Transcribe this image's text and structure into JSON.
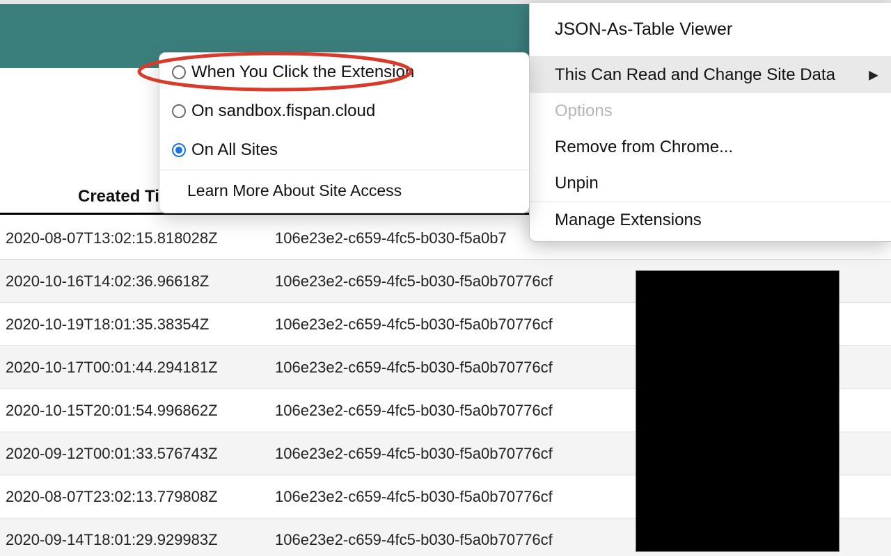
{
  "header": {
    "created_col": "Created Ti"
  },
  "rows": [
    {
      "created": "2020-08-07T13:02:15.818028Z",
      "id": "106e23e2-c659-4fc5-b030-f5a0b7",
      "clipped": true
    },
    {
      "created": "2020-10-16T14:02:36.96618Z",
      "id": "106e23e2-c659-4fc5-b030-f5a0b70776cf"
    },
    {
      "created": "2020-10-19T18:01:35.38354Z",
      "id": "106e23e2-c659-4fc5-b030-f5a0b70776cf"
    },
    {
      "created": "2020-10-17T00:01:44.294181Z",
      "id": "106e23e2-c659-4fc5-b030-f5a0b70776cf"
    },
    {
      "created": "2020-10-15T20:01:54.996862Z",
      "id": "106e23e2-c659-4fc5-b030-f5a0b70776cf"
    },
    {
      "created": "2020-09-12T00:01:33.576743Z",
      "id": "106e23e2-c659-4fc5-b030-f5a0b70776cf"
    },
    {
      "created": "2020-08-07T23:02:13.779808Z",
      "id": "106e23e2-c659-4fc5-b030-f5a0b70776cf"
    },
    {
      "created": "2020-09-14T18:01:29.929983Z",
      "id": "106e23e2-c659-4fc5-b030-f5a0b70776cf"
    }
  ],
  "context_menu": {
    "title": "JSON-As-Table Viewer",
    "read_change": "This Can Read and Change Site Data",
    "options": "Options",
    "remove": "Remove from Chrome...",
    "unpin": "Unpin",
    "manage": "Manage Extensions"
  },
  "submenu": {
    "opt_click": "When You Click the Extension",
    "opt_site": "On sandbox.fispan.cloud",
    "opt_all": "On All Sites",
    "learn": "Learn More About Site Access",
    "selected": "opt_all"
  }
}
